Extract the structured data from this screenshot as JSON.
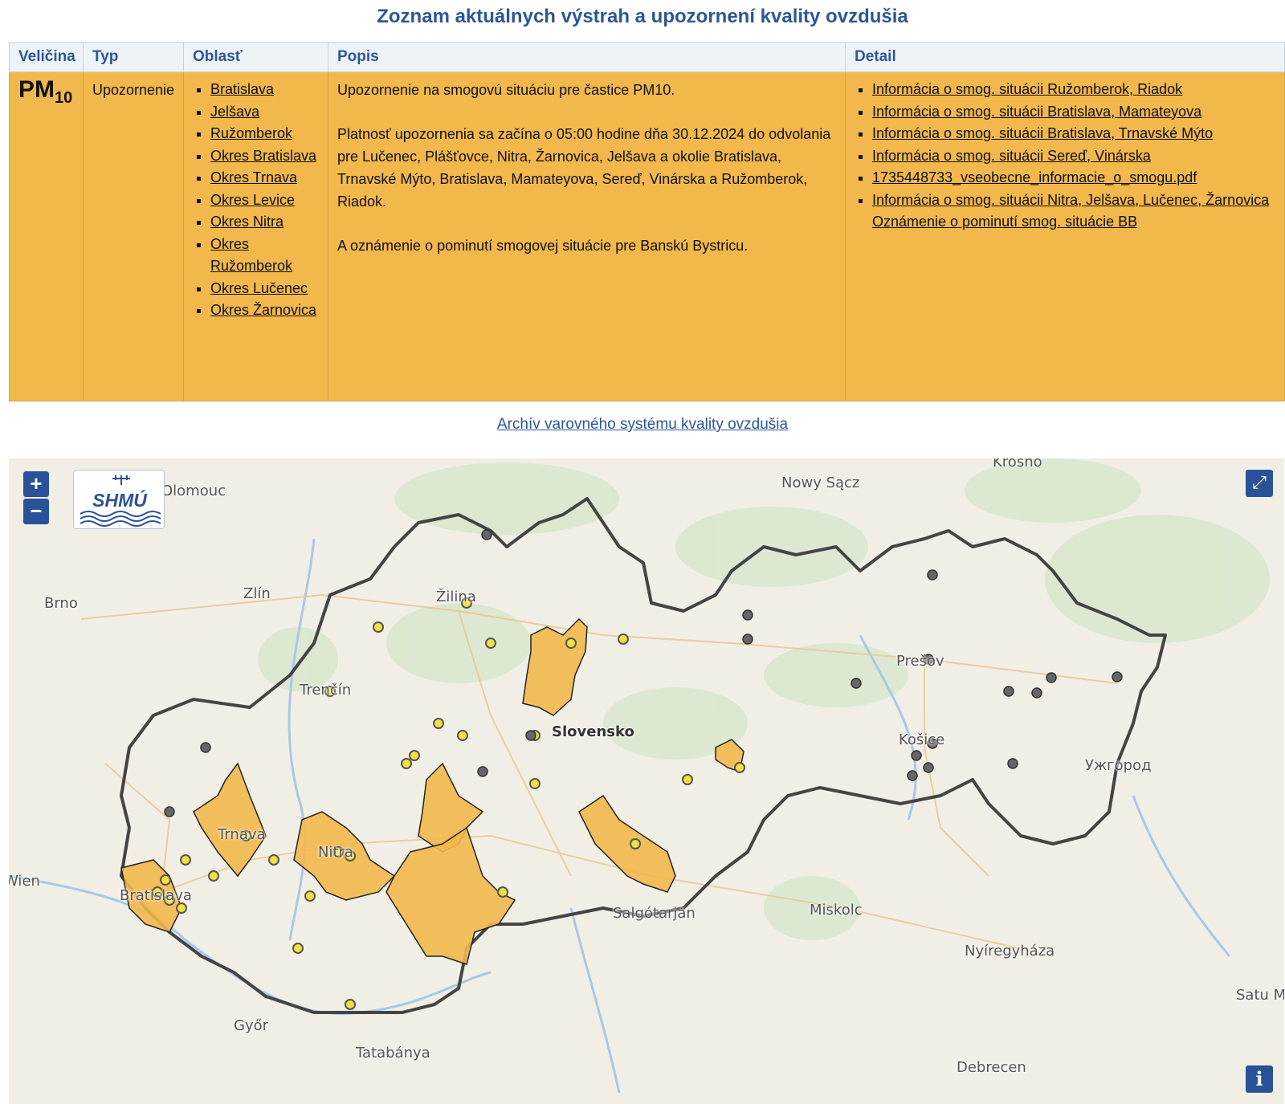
{
  "title": "Zoznam aktuálnych výstrah a upozornení kvality ovzdušia",
  "table": {
    "headers": [
      "Veličina",
      "Typ",
      "Oblasť",
      "Popis",
      "Detail"
    ],
    "row": {
      "quantity": "PM",
      "quantity_sub": "10",
      "type": "Upozornenie",
      "areas": [
        "Bratislava",
        "Jelšava",
        "Ružomberok",
        "Okres Bratislava",
        "Okres Trnava",
        "Okres Levice",
        "Okres Nitra",
        "Okres Ružomberok",
        "Okres Lučenec",
        "Okres Žarnovica"
      ],
      "description": [
        "Upozornenie na smogovú situáciu pre častice PM10.",
        "Platnosť upozornenia sa začína o 05:00 hodine dňa 30.12.2024 do odvolania pre Lučenec, Plášťovce, Nitra, Žarnovica, Jelšava a okolie Bratislava, Trnavské Mýto, Bratislava, Mamateyova, Sereď, Vinárska a Ružomberok, Riadok.",
        "A oznámenie o pominutí smogovej situácie pre Banskú Bystricu."
      ],
      "details": [
        "Informácia o smog. situácii Ružomberok, Riadok",
        "Informácia o smog. situácii Bratislava, Mamateyova",
        "Informácia o smog. situácii Bratislava, Trnavské Mýto",
        "Informácia o smog. situácii Sereď, Vinárska",
        "1735448733_vseobecne_informacie_o_smogu.pdf",
        "Informácia o smog. situácii Nitra, Jelšava, Lučenec, Žarnovica"
      ],
      "detail_extra": "Oznámenie o pominutí smog. situácie BB"
    }
  },
  "archive_link": "Archív varovného systému kvality ovzdušia",
  "map": {
    "zoom_in": "+",
    "zoom_out": "−",
    "logo_text": "SHMÚ",
    "fullscreen_icon": "⤢",
    "info_icon": "i",
    "colors": {
      "alert_fill": "#f2b84b",
      "station_ok": "#f0e040",
      "station_nodata": "#666666",
      "border": "#444444",
      "accent": "#2a5298"
    },
    "places": [
      {
        "name": "Krosno",
        "kind": "city"
      },
      {
        "name": "Nowy Sącz",
        "kind": "city"
      },
      {
        "name": "Olomouc",
        "kind": "city"
      },
      {
        "name": "Brno",
        "kind": "city"
      },
      {
        "name": "Zlín",
        "kind": "city"
      },
      {
        "name": "Žilina",
        "kind": "city"
      },
      {
        "name": "Trenčín",
        "kind": "city"
      },
      {
        "name": "Prešov",
        "kind": "city"
      },
      {
        "name": "Košice",
        "kind": "city"
      },
      {
        "name": "Slovensko",
        "kind": "country"
      },
      {
        "name": "Ужгород",
        "kind": "city"
      },
      {
        "name": "Trnava",
        "kind": "city"
      },
      {
        "name": "Nitra",
        "kind": "city"
      },
      {
        "name": "Wien",
        "kind": "city"
      },
      {
        "name": "Bratislava",
        "kind": "city"
      },
      {
        "name": "Salgótarján",
        "kind": "city"
      },
      {
        "name": "Miskolc",
        "kind": "city"
      },
      {
        "name": "Nyíregyháza",
        "kind": "city"
      },
      {
        "name": "Satu Mare",
        "kind": "city"
      },
      {
        "name": "Győr",
        "kind": "city"
      },
      {
        "name": "Tatabánya",
        "kind": "city"
      },
      {
        "name": "Debrecen",
        "kind": "city"
      }
    ]
  }
}
